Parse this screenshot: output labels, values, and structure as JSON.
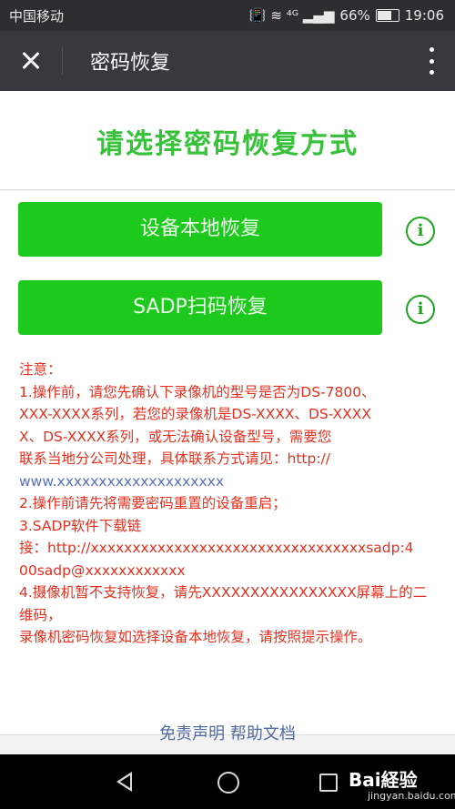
{
  "status_bar": {
    "carrier": "中国移动",
    "signal_icons": "📳 ≋ ⁴ᴳ ▂▄▆",
    "battery": "66%",
    "time": "19:06"
  },
  "app_bar": {
    "title": "密码恢复"
  },
  "page": {
    "heading": "请选择密码恢复方式",
    "local_restore_button": "设备本地恢复",
    "sadp_restore_button": "SADP扫码恢复"
  },
  "notice": {
    "lines": [
      "注意：",
      "1.操作前，请您先确认下录像机的型号是否为DS-7800、",
      "XXX-XXXX系列，若您的录像机是DS-XXXX、DS-XXXX",
      "X、DS-XXXX系列，或无法确认设备型号，需要您",
      "联系当地分公司处理，具体联系方式请见：http://",
      "www.xxxxxxxxxxxxxxxxxxxx",
      "2.操作前请先将需要密码重置的设备重启；",
      "3.SADP软件下载链",
      "接：http://xxxxxxxxxxxxxxxxxxxxxxxxxxxxxxxxxsadp:4",
      "00sadp@xxxxxxxxxxxx",
      "4.摄像机暂不支持恢复，请先XXXXXXXXXXXXXXXX屏幕上的二维码，",
      "录像机密码恢复如选择设备本地恢复，请按照提示操作。"
    ]
  },
  "footer": {
    "disclaimer": "免责声明",
    "help": "帮助文档"
  },
  "watermark": {
    "text": "Bai経验",
    "sub": "jingyan.baidu.com"
  },
  "colors": {
    "accent_green": "#1ec91e",
    "heading_green": "#37c23a",
    "notice_red": "#e5301f",
    "link_blue": "#4f6aa0",
    "appbar_bg": "#38383d"
  }
}
